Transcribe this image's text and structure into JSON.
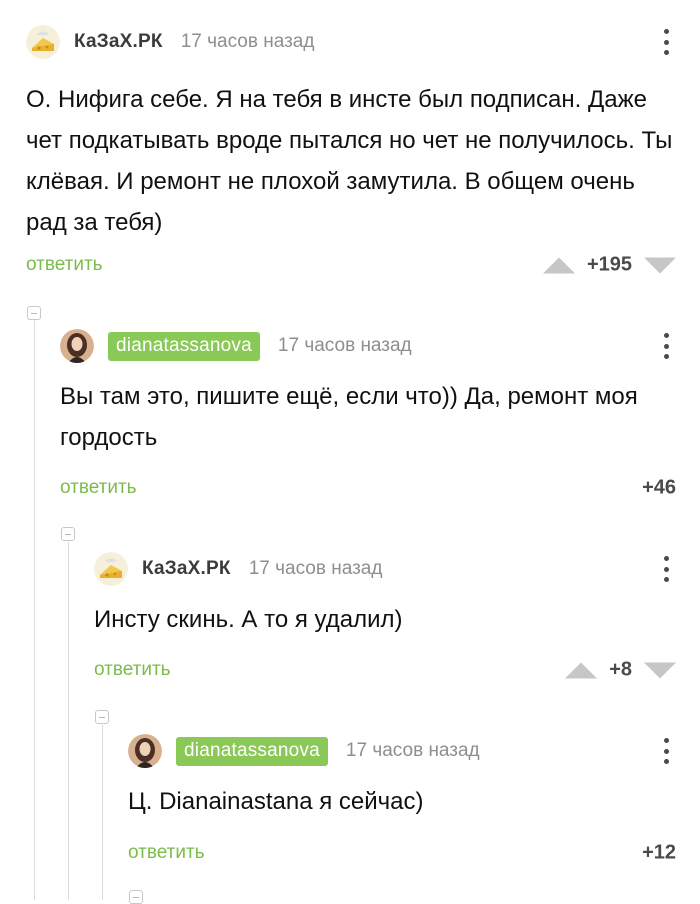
{
  "comments": [
    {
      "author": "КаЗаХ.РК",
      "time": "17 часов назад",
      "text": "О. Нифига себе. Я на тебя в инсте был подписан. Даже чет подкатывать вроде пытался но чет не получилось. Ты клёвая. И ремонт не плохой замутила. В общем очень рад за тебя)",
      "reply": "ответить",
      "score": "+195"
    },
    {
      "author": "dianatassanova",
      "time": "17 часов назад",
      "text": "Вы там это, пишите ещё, если что)) Да, ремонт моя гордость",
      "reply": "ответить",
      "score": "+46"
    },
    {
      "author": "КаЗаХ.РК",
      "time": "17 часов назад",
      "text": "Инсту скинь. А то я удалил)",
      "reply": "ответить",
      "score": "+8"
    },
    {
      "author": "dianatassanova",
      "time": "17 часов назад",
      "text": "Ц. Dianainastana я сейчас)",
      "reply": "ответить",
      "score": "+12"
    }
  ],
  "icons": {
    "avatar_kazakh": "cheese-avatar-icon",
    "avatar_diana": "user-photo-avatar",
    "menu": "more-vertical-icon",
    "collapse": "collapse-thread-icon",
    "vote_up": "triangle-up-icon",
    "vote_down": "triangle-down-icon"
  },
  "colors": {
    "accent": "#7cbb4c",
    "author_badge": "#8ac858",
    "muted": "#8e8e8e",
    "vote": "#c6c6c6"
  }
}
